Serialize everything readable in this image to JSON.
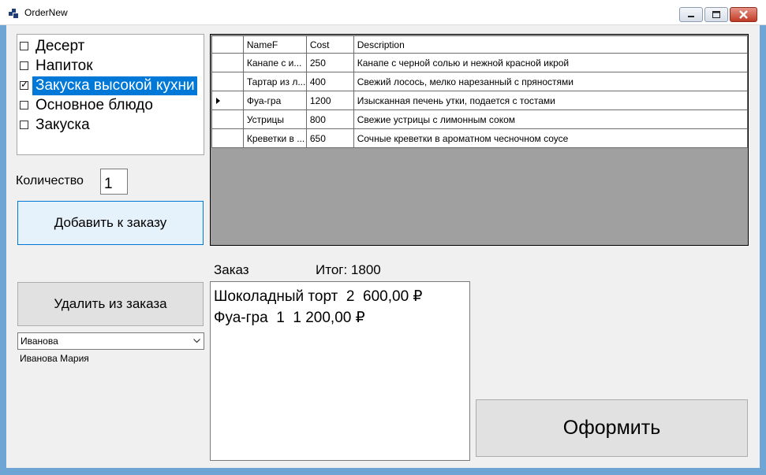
{
  "window": {
    "title": "OrderNew",
    "controls": {
      "minimize": "minimize-icon",
      "maximize": "maximize-icon",
      "close": "close-icon"
    }
  },
  "categories": {
    "items": [
      {
        "label": "Десерт",
        "checked": false,
        "selected": false
      },
      {
        "label": "Напиток",
        "checked": false,
        "selected": false
      },
      {
        "label": "Закуска высокой кухни",
        "checked": true,
        "selected": true
      },
      {
        "label": "Основное блюдо",
        "checked": false,
        "selected": false
      },
      {
        "label": "Закуска",
        "checked": false,
        "selected": false
      }
    ]
  },
  "quantity": {
    "label": "Количество",
    "value": "1"
  },
  "buttons": {
    "add": "Добавить к заказу",
    "remove": "Удалить из заказа",
    "submit": "Оформить"
  },
  "client": {
    "selected": "Иванова",
    "full_name": "Иванова Мария"
  },
  "grid": {
    "columns": [
      "NameF",
      "Cost",
      "Description"
    ],
    "rows": [
      {
        "name": "Канапе с и...",
        "cost": "250",
        "description": "Канапе с черной солью и нежной красной икрой",
        "current": false
      },
      {
        "name": "Тартар из л...",
        "cost": "400",
        "description": "Свежий лосось, мелко нарезанный с пряностями",
        "current": false
      },
      {
        "name": "Фуа-гра",
        "cost": "1200",
        "description": "Изысканная печень утки, подается с тостами",
        "current": true
      },
      {
        "name": "Устрицы",
        "cost": "800",
        "description": "Свежие устрицы с лимонным соком",
        "current": false
      },
      {
        "name": "Креветки в ...",
        "cost": "650",
        "description": "Сочные креветки в ароматном чесночном соусе",
        "current": false
      }
    ]
  },
  "order": {
    "label": "Заказ",
    "total_label": "Итог: 1800",
    "lines": [
      "Шоколадный торт  2  600,00 ₽",
      "Фуа-гра  1  1 200,00 ₽"
    ]
  },
  "colors": {
    "selection": "#0078d7",
    "grid_background": "#a0a0a0",
    "window_frame": "#6fa5d4"
  }
}
